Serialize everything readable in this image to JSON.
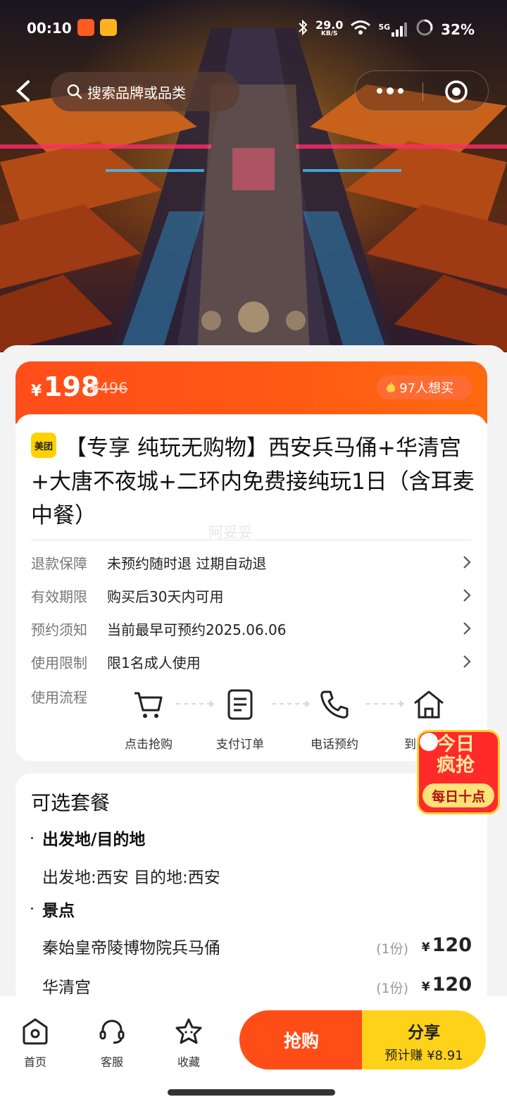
{
  "status_bar": {
    "time": "00:10",
    "network_speed_value": "29.0",
    "network_speed_unit": "KB/S",
    "signal": "5G",
    "battery": "32%"
  },
  "search": {
    "placeholder": "搜索品牌或品类"
  },
  "price": {
    "currency": "¥",
    "current": "198",
    "original": "¥496",
    "want_count": "97人想买"
  },
  "product": {
    "logo_text": "美团",
    "title": "【专享 纯玩无购物】西安兵马俑+华清宫+大唐不夜城+二环内免费接纯玩1日（含耳麦 中餐）",
    "watermark": "阿妥妥"
  },
  "info_rows": [
    {
      "key": "退款保障",
      "value": "未预约随时退 过期自动退"
    },
    {
      "key": "有效期限",
      "value": "购买后30天内可用"
    },
    {
      "key": "预约须知",
      "value": "当前最早可预约2025.06.06"
    },
    {
      "key": "使用限制",
      "value": "限1名成人使用"
    }
  ],
  "flow": {
    "label": "使用流程",
    "steps": [
      {
        "icon": "cart-icon",
        "label": "点击抢购"
      },
      {
        "icon": "document-icon",
        "label": "支付订单"
      },
      {
        "icon": "phone-icon",
        "label": "电话预约"
      },
      {
        "icon": "home-icon",
        "label": "到"
      }
    ]
  },
  "promo": {
    "line1": "今日",
    "line2": "疯抢",
    "bottom": "每日十点"
  },
  "packages": {
    "title": "可选套餐",
    "sections": [
      {
        "heading": "出发地/目的地",
        "text": "出发地:西安 目的地:西安"
      },
      {
        "heading": "景点"
      }
    ],
    "items": [
      {
        "name": "秦始皇帝陵博物院兵马俑",
        "qty": "(1份)",
        "currency": "¥",
        "price": "120"
      },
      {
        "name": "华清宫",
        "qty": "(1份)",
        "currency": "¥",
        "price": "120"
      }
    ]
  },
  "bottom_bar": {
    "tabs": [
      {
        "icon": "home-icon",
        "label": "首页"
      },
      {
        "icon": "customer-service-icon",
        "label": "客服"
      },
      {
        "icon": "star-icon",
        "label": "收藏"
      }
    ],
    "buy_label": "抢购",
    "share_label": "分享",
    "share_sub": "预计赚 ¥8.91"
  },
  "colors": {
    "accent_orange": "#ff4d18",
    "share_yellow": "#ffd21a",
    "meituan_yellow": "#ffd100"
  }
}
